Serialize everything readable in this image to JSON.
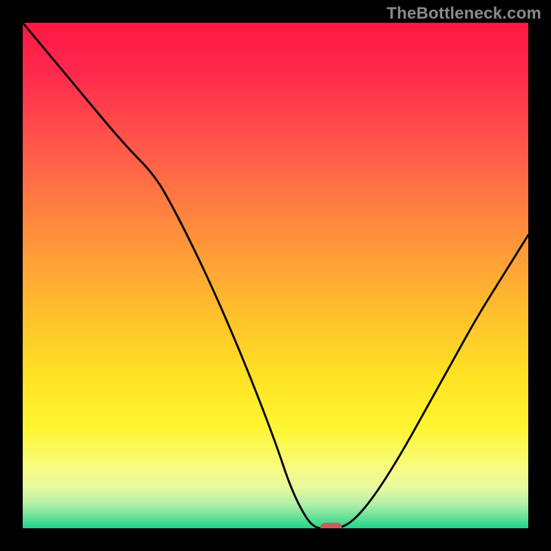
{
  "watermark": {
    "text": "TheBottleneck.com"
  },
  "chart_data": {
    "type": "line",
    "title": "",
    "xlabel": "",
    "ylabel": "",
    "xlim": [
      0,
      100
    ],
    "ylim": [
      0,
      100
    ],
    "grid": false,
    "legend": false,
    "background": "traffic-light vertical gradient (red→orange→yellow→green)",
    "series": [
      {
        "name": "bottleneck-curve",
        "x": [
          0,
          10,
          20,
          26,
          30,
          35,
          40,
          45,
          50,
          53,
          56,
          58,
          60,
          63,
          66,
          70,
          75,
          80,
          85,
          90,
          95,
          100
        ],
        "y": [
          100,
          88,
          76,
          70,
          63,
          53,
          42,
          30,
          17,
          8,
          2,
          0,
          0,
          0,
          2,
          7,
          15,
          24,
          33,
          42,
          50,
          58
        ]
      }
    ],
    "marker": {
      "x": 61,
      "y": 0,
      "shape": "rounded-rect",
      "color": "#cd5c5c"
    },
    "gradient_stops": [
      {
        "offset": 0.0,
        "color": "#ff1744"
      },
      {
        "offset": 0.1,
        "color": "#ff2a4d"
      },
      {
        "offset": 0.25,
        "color": "#ff5a4a"
      },
      {
        "offset": 0.4,
        "color": "#ff8a3d"
      },
      {
        "offset": 0.55,
        "color": "#ffb92e"
      },
      {
        "offset": 0.7,
        "color": "#ffe224"
      },
      {
        "offset": 0.8,
        "color": "#fff531"
      },
      {
        "offset": 0.88,
        "color": "#f7fb80"
      },
      {
        "offset": 0.92,
        "color": "#e6f9a0"
      },
      {
        "offset": 0.95,
        "color": "#b8f0a8"
      },
      {
        "offset": 0.975,
        "color": "#70e29b"
      },
      {
        "offset": 1.0,
        "color": "#1fd58a"
      }
    ]
  }
}
